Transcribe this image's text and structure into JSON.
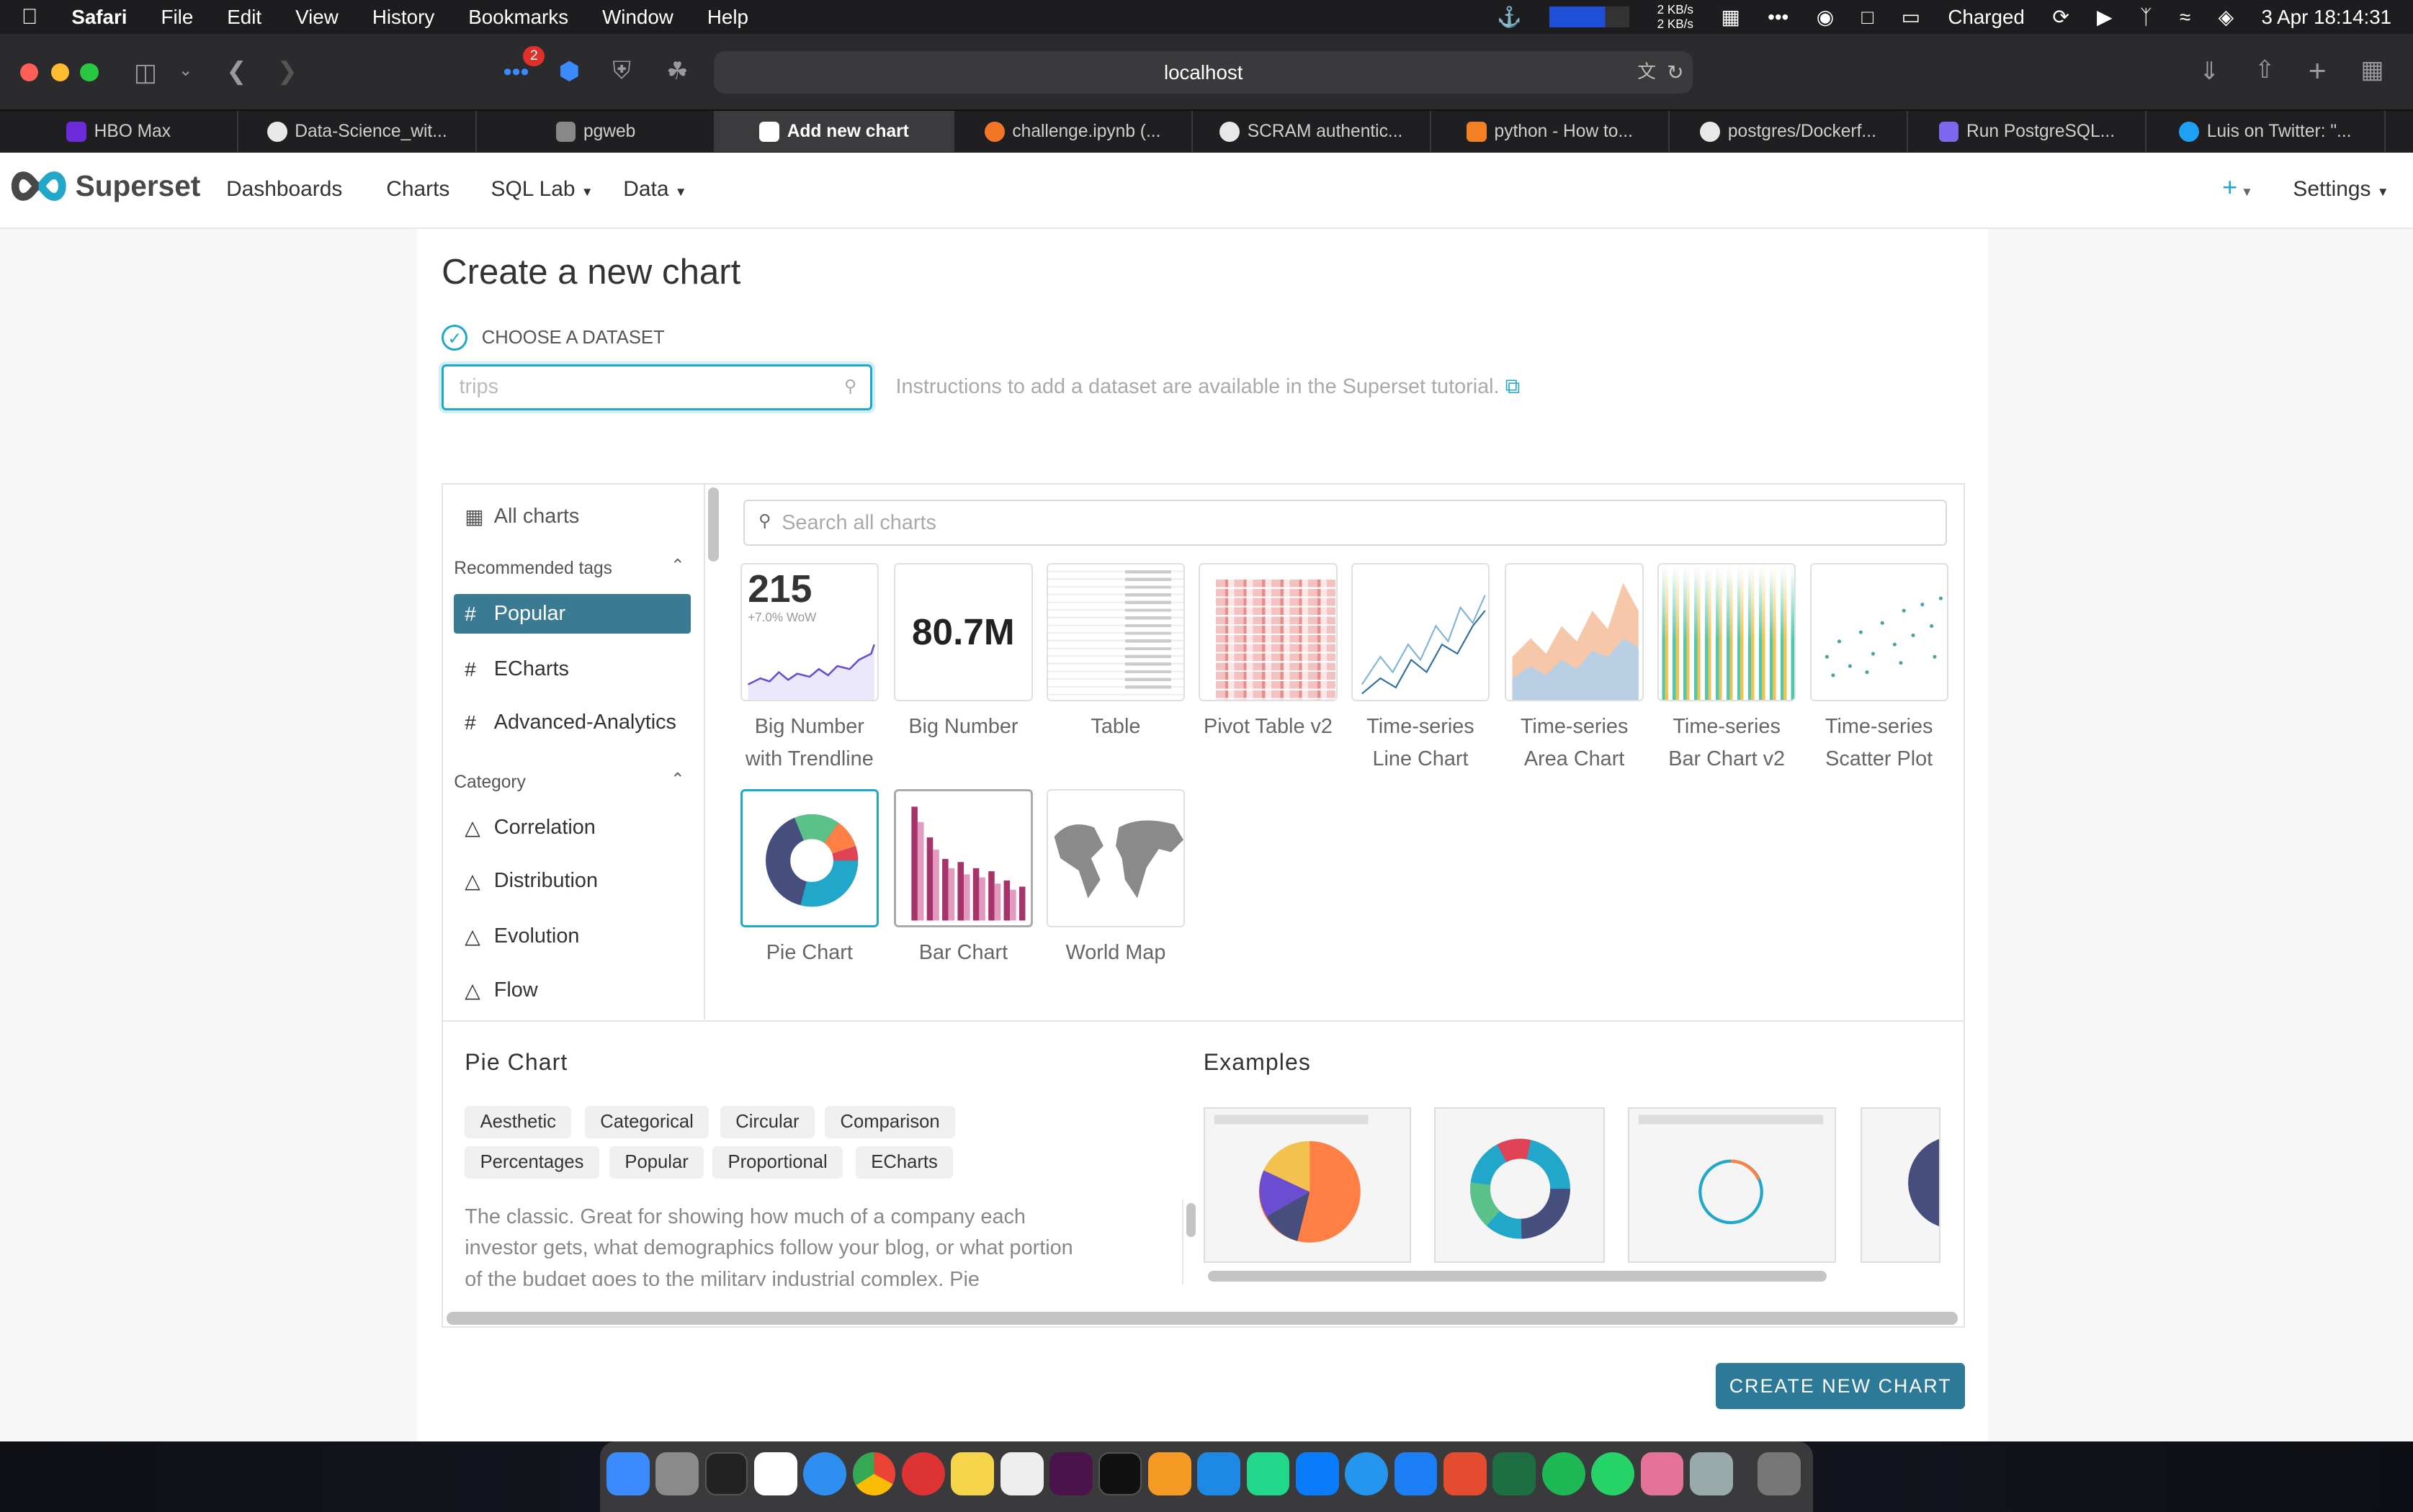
{
  "menubar": {
    "app": "Safari",
    "items": [
      "File",
      "Edit",
      "View",
      "History",
      "Bookmarks",
      "Window",
      "Help"
    ],
    "net_up": "2 KB/s",
    "net_down": "2 KB/s",
    "battery_status": "Charged",
    "datetime": "3 Apr  18:14:31"
  },
  "browser": {
    "url": "localhost",
    "notification_count": "2",
    "tabs": [
      {
        "label": "HBO Max",
        "color": "#6c2bd9"
      },
      {
        "label": "Data-Science_wit...",
        "color": "#e8e8e8"
      },
      {
        "label": "pgweb",
        "color": "#9e9e9e"
      },
      {
        "label": "Add new chart",
        "color": "#ffffff",
        "active": true
      },
      {
        "label": "challenge.ipynb (...",
        "color": "#f37626"
      },
      {
        "label": "SCRAM authentic...",
        "color": "#e8e8e8"
      },
      {
        "label": "python - How to...",
        "color": "#f48024"
      },
      {
        "label": "postgres/Dockerf...",
        "color": "#e8e8e8"
      },
      {
        "label": "Run PostgreSQL...",
        "color": "#7b68ee"
      },
      {
        "label": "Luis on Twitter: \"...",
        "color": "#1da1f2"
      }
    ]
  },
  "superset": {
    "brand": "Superset",
    "nav": {
      "dashboards": "Dashboards",
      "charts": "Charts",
      "sql_lab": "SQL Lab",
      "data": "Data",
      "settings": "Settings"
    },
    "page_title": "Create a new chart",
    "step_label": "CHOOSE A DATASET",
    "dataset_placeholder": "trips",
    "dataset_option": "trips",
    "instructions": "Instructions to add a dataset are available in the Superset tutorial.",
    "sidebar": {
      "all_charts": "All charts",
      "recommended_heading": "Recommended tags",
      "tags": [
        "Popular",
        "ECharts",
        "Advanced-Analytics"
      ],
      "category_heading": "Category",
      "categories": [
        "Correlation",
        "Distribution",
        "Evolution",
        "Flow"
      ]
    },
    "search_placeholder": "Search all charts",
    "charts": [
      {
        "l1": "Big Number",
        "l2": "with Trendline"
      },
      {
        "l1": "Big Number",
        "l2": ""
      },
      {
        "l1": "Table",
        "l2": ""
      },
      {
        "l1": "Pivot Table v2",
        "l2": ""
      },
      {
        "l1": "Time-series",
        "l2": "Line Chart"
      },
      {
        "l1": "Time-series",
        "l2": "Area Chart"
      },
      {
        "l1": "Time-series",
        "l2": "Bar Chart v2"
      },
      {
        "l1": "Time-series",
        "l2": "Scatter Plot"
      },
      {
        "l1": "Pie Chart",
        "l2": ""
      },
      {
        "l1": "Bar Chart",
        "l2": ""
      },
      {
        "l1": "World Map",
        "l2": ""
      }
    ],
    "thumb_big_number": "215",
    "thumb_big_number_sub": "+7.0% WoW",
    "thumb_big_number2": "80.7M",
    "detail": {
      "name": "Pie Chart",
      "examples_heading": "Examples",
      "tags": [
        "Aesthetic",
        "Categorical",
        "Circular",
        "Comparison",
        "Percentages",
        "Popular",
        "Proportional",
        "ECharts"
      ],
      "description": "The classic. Great for showing how much of a company each investor gets, what demographics follow your blog, or what portion of the budget goes to the military industrial complex. Pie"
    },
    "create_button": "CREATE NEW CHART"
  }
}
